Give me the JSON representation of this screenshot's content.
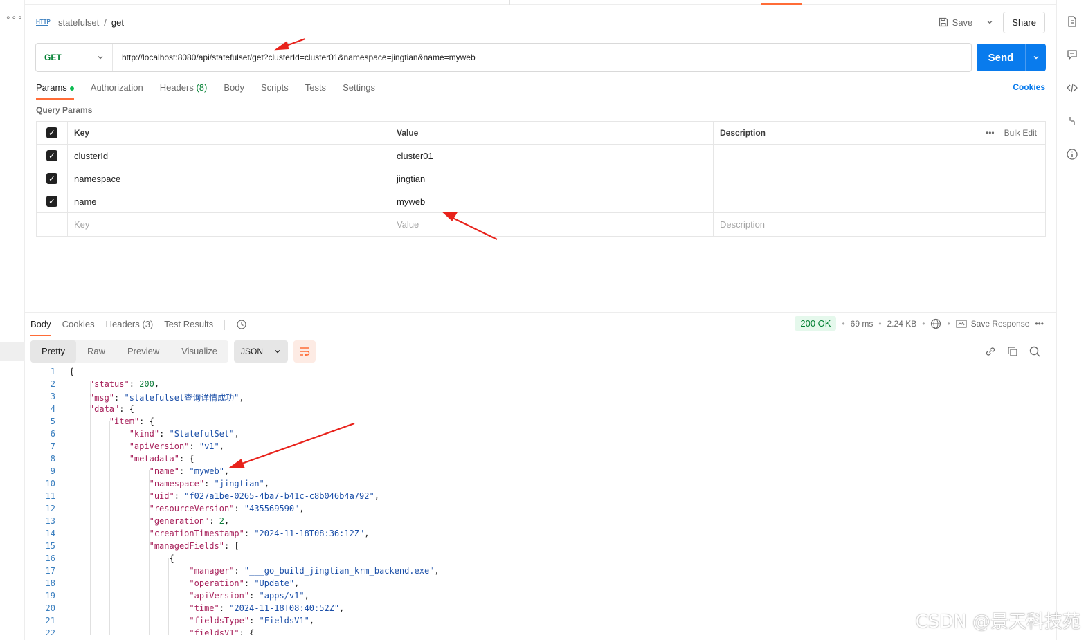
{
  "breadcrumb": {
    "collection": "statefulset",
    "separator": "/",
    "request": "get",
    "badge": "HTTP"
  },
  "header": {
    "save_label": "Save",
    "share_label": "Share"
  },
  "request": {
    "method": "GET",
    "url": "http://localhost:8080/api/statefulset/get?clusterId=cluster01&namespace=jingtian&name=myweb",
    "send_label": "Send"
  },
  "req_tabs": {
    "params": "Params",
    "authorization": "Authorization",
    "headers": "Headers",
    "headers_count": "(8)",
    "body": "Body",
    "scripts": "Scripts",
    "tests": "Tests",
    "settings": "Settings",
    "cookies": "Cookies"
  },
  "query_params": {
    "title": "Query Params",
    "headers": {
      "key": "Key",
      "value": "Value",
      "description": "Description",
      "bulk_edit": "Bulk Edit"
    },
    "rows": [
      {
        "key": "clusterId",
        "value": "cluster01"
      },
      {
        "key": "namespace",
        "value": "jingtian"
      },
      {
        "key": "name",
        "value": "myweb"
      }
    ],
    "placeholders": {
      "key": "Key",
      "value": "Value",
      "description": "Description"
    }
  },
  "resp_tabs": {
    "body": "Body",
    "cookies": "Cookies",
    "headers": "Headers",
    "headers_count": "(3)",
    "test_results": "Test Results"
  },
  "resp_meta": {
    "status": "200 OK",
    "time": "69 ms",
    "size": "2.24 KB",
    "save_response": "Save Response"
  },
  "view": {
    "pretty": "Pretty",
    "raw": "Raw",
    "preview": "Preview",
    "visualize": "Visualize",
    "format": "JSON"
  },
  "code": {
    "line_numbers": [
      "1",
      "2",
      "3",
      "4",
      "5",
      "6",
      "7",
      "8",
      "9",
      "10",
      "11",
      "12",
      "13",
      "14",
      "15",
      "16",
      "17",
      "18",
      "19",
      "20",
      "21",
      "22"
    ],
    "status_key": "\"status\"",
    "status_val": "200",
    "msg_key": "\"msg\"",
    "msg_val": "\"statefulset查询详情成功\"",
    "data_key": "\"data\"",
    "item_key": "\"item\"",
    "kind_key": "\"kind\"",
    "kind_val": "\"StatefulSet\"",
    "apiVersion_key": "\"apiVersion\"",
    "apiVersion_val": "\"v1\"",
    "metadata_key": "\"metadata\"",
    "name_key": "\"name\"",
    "name_val": "\"myweb\"",
    "namespace_key": "\"namespace\"",
    "namespace_val": "\"jingtian\"",
    "uid_key": "\"uid\"",
    "uid_val": "\"f027a1be-0265-4ba7-b41c-c8b046b4a792\"",
    "resourceVersion_key": "\"resourceVersion\"",
    "resourceVersion_val": "\"435569590\"",
    "generation_key": "\"generation\"",
    "generation_val": "2",
    "creationTimestamp_key": "\"creationTimestamp\"",
    "creationTimestamp_val": "\"2024-11-18T08:36:12Z\"",
    "managedFields_key": "\"managedFields\"",
    "manager_key": "\"manager\"",
    "manager_val": "\"___go_build_jingtian_krm_backend.exe\"",
    "operation_key": "\"operation\"",
    "operation_val": "\"Update\"",
    "apiVersion2_key": "\"apiVersion\"",
    "apiVersion2_val": "\"apps/v1\"",
    "time_key": "\"time\"",
    "time_val": "\"2024-11-18T08:40:52Z\"",
    "fieldsType_key": "\"fieldsType\"",
    "fieldsType_val": "\"FieldsV1\"",
    "fieldsV1_key": "\"fieldsV1\""
  },
  "watermark": "CSDN @景天科技苑",
  "colors": {
    "accent": "#ff6c37",
    "send": "#097bed",
    "method": "#007f31",
    "annotation_arrow": "#e8221b"
  }
}
